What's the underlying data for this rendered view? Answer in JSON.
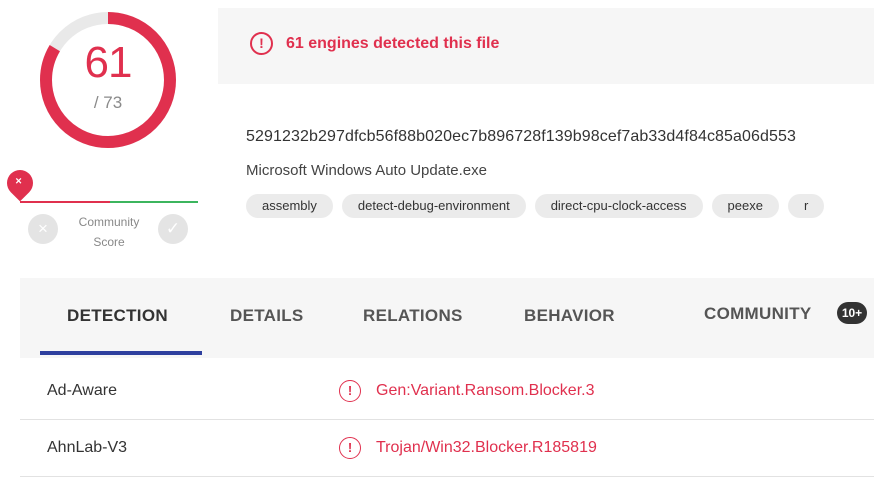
{
  "score": {
    "detected": "61",
    "total": "/ 73",
    "detected_value": 61,
    "total_value": 73,
    "gauge_color": "#e0304e",
    "track_color": "#e9e9e9"
  },
  "community": {
    "marker_icon": "×",
    "label": "Community Score",
    "downvote_icon": "×",
    "upvote_icon": "✓",
    "negative_color": "#e0304e",
    "positive_color": "#3cb55e"
  },
  "banner": {
    "icon": "!",
    "text": "61 engines detected this file"
  },
  "file": {
    "hash": "5291232b297dfcb56f88b020ec7b896728f139b98cef7ab33d4f84c85a06d553",
    "name": "Microsoft Windows Auto Update.exe",
    "tags": [
      "assembly",
      "detect-debug-environment",
      "direct-cpu-clock-access",
      "peexe",
      "r"
    ]
  },
  "tabs": [
    {
      "label": "DETECTION",
      "active": true
    },
    {
      "label": "DETAILS",
      "active": false
    },
    {
      "label": "RELATIONS",
      "active": false
    },
    {
      "label": "BEHAVIOR",
      "active": false
    },
    {
      "label": "COMMUNITY",
      "active": false
    }
  ],
  "community_badge": "10+",
  "detections": [
    {
      "engine": "Ad-Aware",
      "icon": "!",
      "result": "Gen:Variant.Ransom.Blocker.3"
    },
    {
      "engine": "AhnLab-V3",
      "icon": "!",
      "result": "Trojan/Win32.Blocker.R185819"
    }
  ],
  "accent_color": "#e0304e",
  "tab_underline_color": "#2e3f9e"
}
